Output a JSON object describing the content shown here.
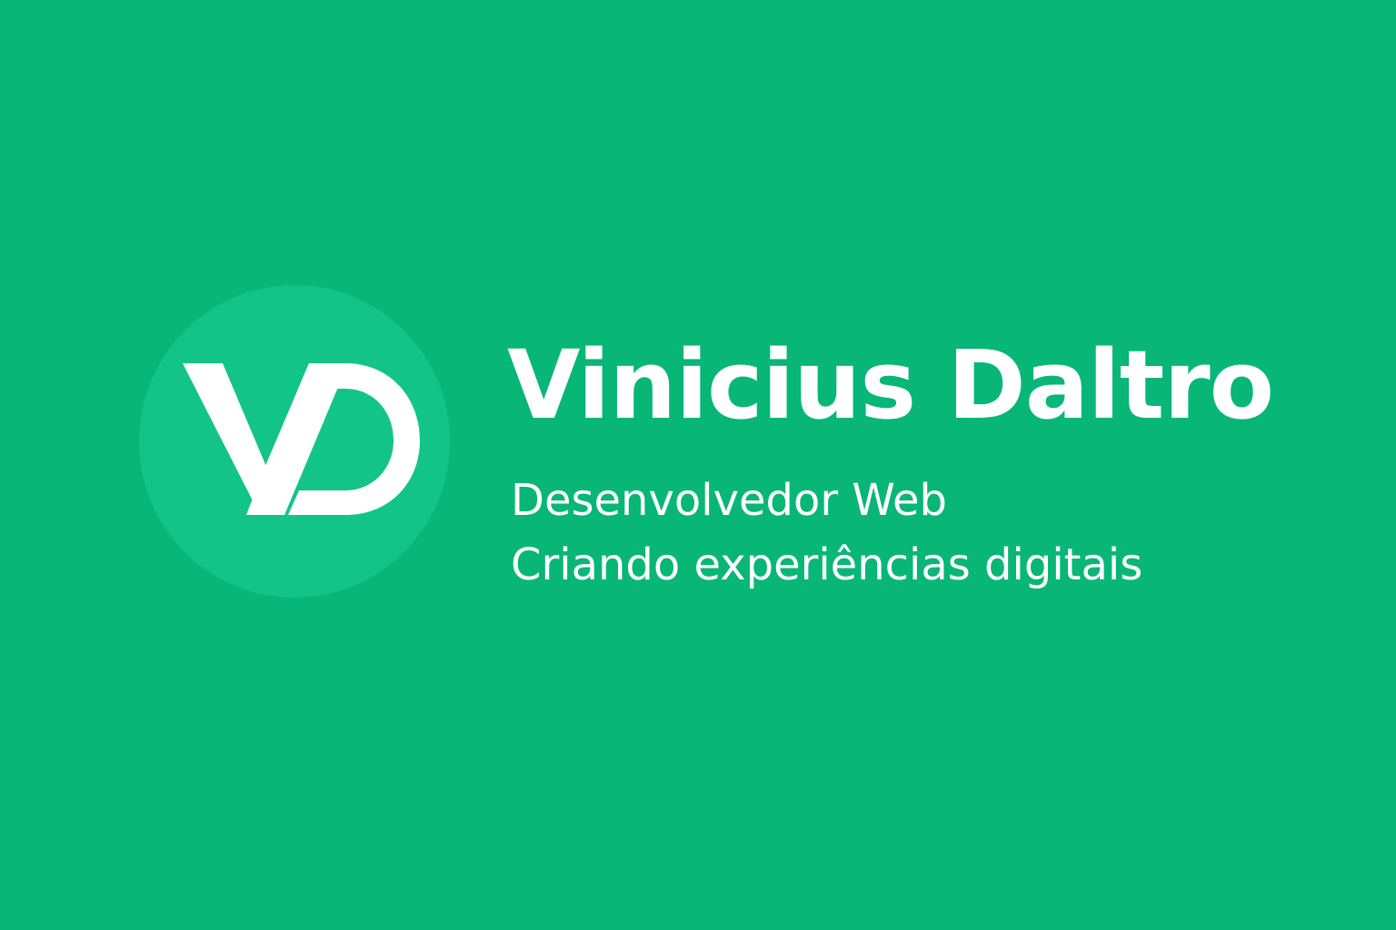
{
  "colors": {
    "background": "#08b678",
    "logo_circle": "#13c489",
    "text": "#ffffff"
  },
  "logo": {
    "icon": "vd-monogram-logo",
    "monogram": "VD"
  },
  "brand": {
    "name": "Vinicius Daltro",
    "role": "Desenvolvedor Web",
    "tagline": "Criando experiências digitais"
  }
}
